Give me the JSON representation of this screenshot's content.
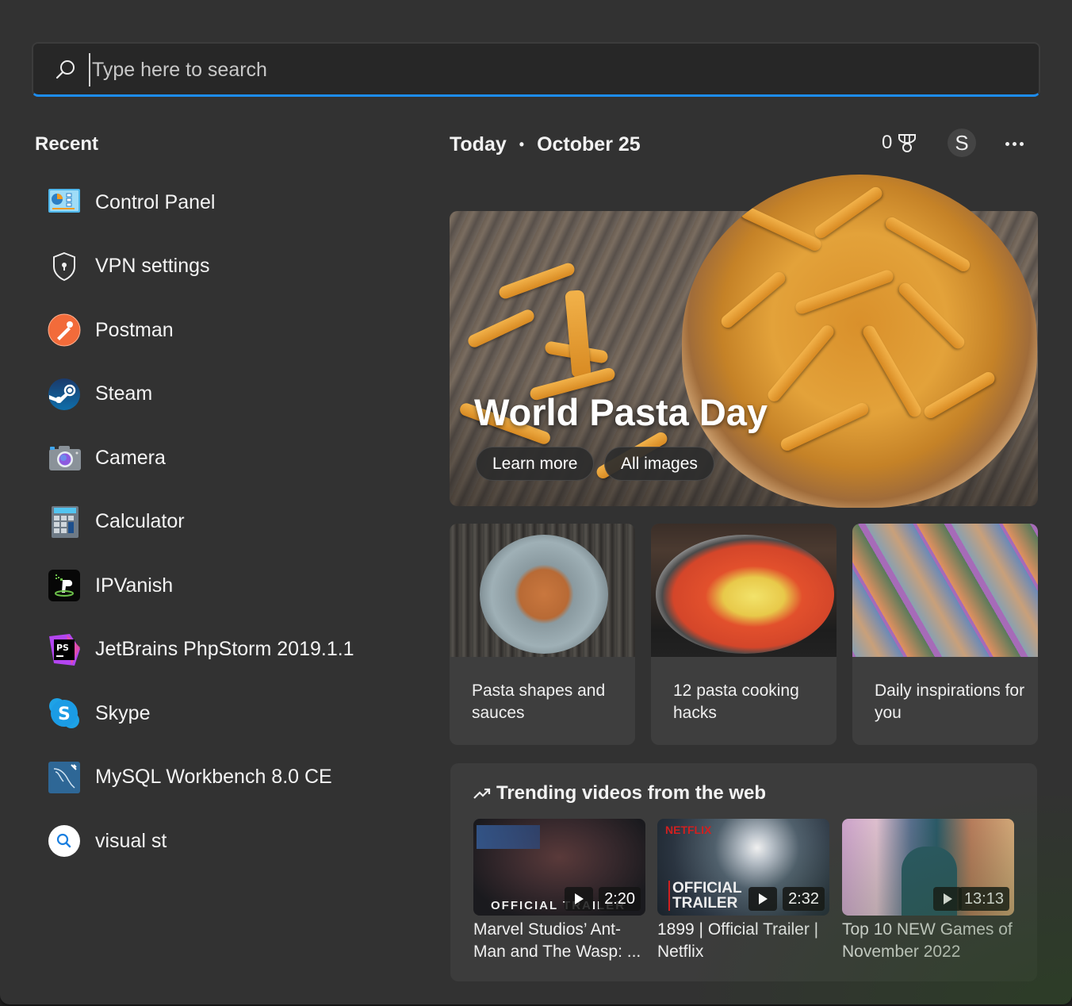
{
  "search": {
    "placeholder": "Type here to search",
    "value": "",
    "icon": "search-icon",
    "accent_color": "#1d8cf0"
  },
  "recent": {
    "title": "Recent",
    "items": [
      {
        "label": "Control Panel",
        "icon": "control-panel-icon"
      },
      {
        "label": "VPN settings",
        "icon": "shield-lock-icon"
      },
      {
        "label": "Postman",
        "icon": "postman-icon"
      },
      {
        "label": "Steam",
        "icon": "steam-icon"
      },
      {
        "label": "Camera",
        "icon": "camera-icon"
      },
      {
        "label": "Calculator",
        "icon": "calculator-icon"
      },
      {
        "label": "IPVanish",
        "icon": "ipvanish-icon"
      },
      {
        "label": "JetBrains PhpStorm 2019.1.1",
        "icon": "phpstorm-icon"
      },
      {
        "label": "Skype",
        "icon": "skype-icon"
      },
      {
        "label": "MySQL Workbench 8.0 CE",
        "icon": "mysql-workbench-icon"
      },
      {
        "label": "visual st",
        "icon": "web-search-icon"
      }
    ]
  },
  "today": {
    "label": "Today",
    "separator": "•",
    "date": "October 25",
    "rewards_points": "0",
    "avatar_initial": "S"
  },
  "hero": {
    "title": "World Pasta Day",
    "buttons": [
      "Learn more",
      "All images"
    ]
  },
  "cards": [
    {
      "title": "Pasta shapes and sauces"
    },
    {
      "title": "12 pasta cooking hacks"
    },
    {
      "title": "Daily inspirations for you"
    }
  ],
  "trending": {
    "title": "Trending videos from the web",
    "videos": [
      {
        "title": "Marvel Studios’ Ant-Man and The Wasp: ...",
        "duration": "2:20",
        "thumb_text": "OFFICIAL TRAILER"
      },
      {
        "title": "1899 | Official Trailer | Netflix",
        "duration": "2:32",
        "thumb_text": "OFFICIAL TRAILER",
        "thumb_brand": "NETFLIX"
      },
      {
        "title": "Top 10 NEW Games of November 2022",
        "duration": "13:13"
      }
    ]
  }
}
